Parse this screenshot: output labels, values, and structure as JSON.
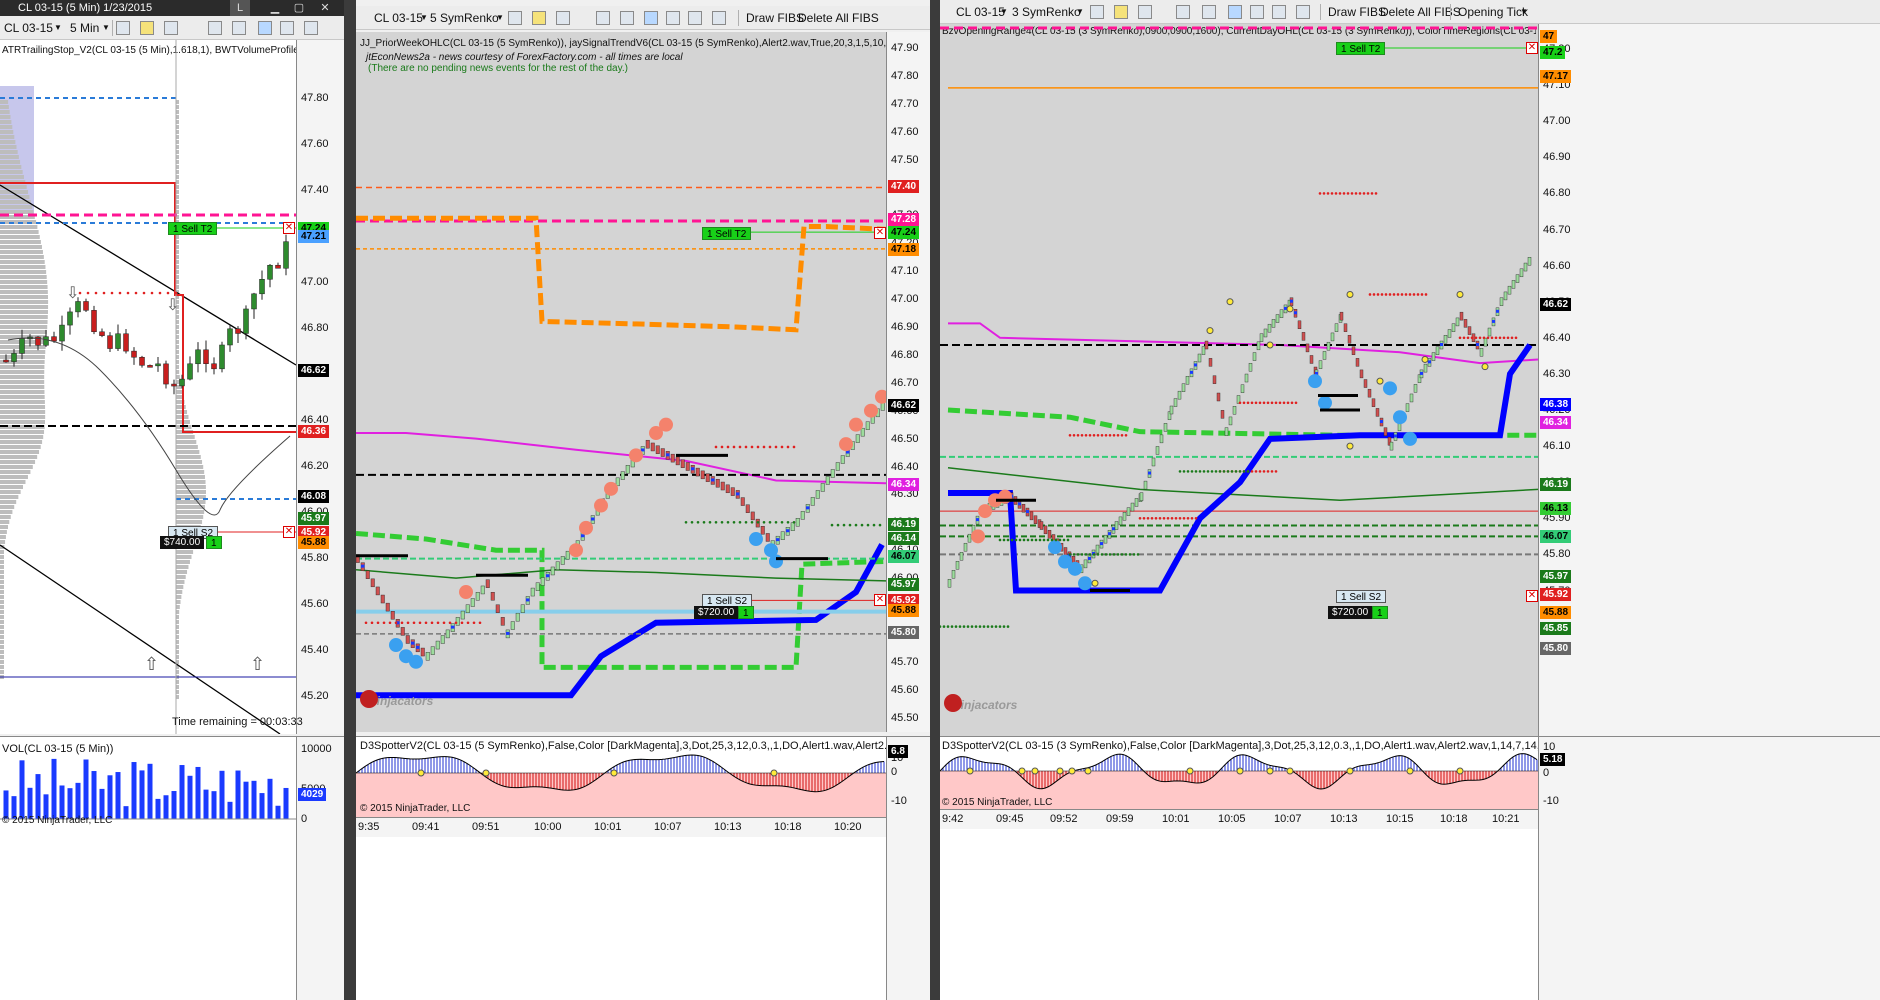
{
  "colors": {
    "bull": "#2e8b2e",
    "bear": "#c81e1e",
    "blue_trend": "#0000ff",
    "green_dash": "#33cc33",
    "orange_dash": "#ff8c00",
    "magenta": "#e020e0",
    "pink_dash": "#ff1493",
    "salmon": "#f4826c",
    "sky": "#3aa0f0"
  },
  "left": {
    "title": "CL 03-15 (5 Min)  1/23/2015",
    "title_btn": "L",
    "toolbar": {
      "instrument": "CL 03-15",
      "interval": "5 Min"
    },
    "indicator_label": "ATRTrailingStop_V2(CL 03-15 (5 Min),1.618,1), BWTVolumeProfile(CL",
    "axis_ticks": [
      "47.80",
      "47.60",
      "47.40",
      "47.20",
      "47.00",
      "46.80",
      "46.60",
      "46.40",
      "46.20",
      "46.00",
      "45.80",
      "45.60",
      "45.40",
      "45.20"
    ],
    "tags": [
      {
        "text": "47.24",
        "bg": "#18d018",
        "color": "#000"
      },
      {
        "text": "47.21",
        "bg": "#4aa0ff",
        "color": "#000"
      },
      {
        "text": "46.62",
        "bg": "#000",
        "color": "#fff"
      },
      {
        "text": "46.36",
        "bg": "#e02020",
        "color": "#fff"
      },
      {
        "text": "46.08",
        "bg": "#000",
        "color": "#fff"
      },
      {
        "text": "45.97",
        "bg": "#1b7a1b",
        "color": "#fff"
      },
      {
        "text": "45.92",
        "bg": "#e02020",
        "color": "#fff"
      },
      {
        "text": "45.88",
        "bg": "#ff8c00",
        "color": "#000"
      }
    ],
    "order_t2": "1  Sell T2",
    "order_s2": "1  Sell S2",
    "pl": "$740.00",
    "pl_qty": "1",
    "time_remaining": "Time remaining = 00:03:33",
    "vol_label": "VOL(CL 03-15 (5 Min))",
    "vol_ticks": [
      "10000",
      "5000",
      "0"
    ],
    "vol_tag": "4029",
    "copyright": "© 2015 NinjaTrader, LLC"
  },
  "middle": {
    "toolbar": {
      "instrument": "CL 03-15",
      "interval": "5 SymRenko",
      "draw_fibs": "Draw FIBS",
      "delete_fibs": "Delete All FIBS"
    },
    "indicator_label": "JJ_PriorWeekOHLC(CL 03-15 (5 SymRenko)), jaySignalTrendV6(CL 03-15 (5 SymRenko),Alert2.wav,True,20,3,1,5,10,20,20,20",
    "news_title": "jtEconNews2a - news courtesy of ForexFactory.com - all times are local",
    "news_msg": "(There are no pending news events for the rest of the day.)",
    "axis_ticks": [
      "47.90",
      "47.80",
      "47.70",
      "47.60",
      "47.50",
      "47.40",
      "47.30",
      "47.20",
      "47.10",
      "47.00",
      "46.90",
      "46.80",
      "46.70",
      "46.60",
      "46.50",
      "46.40",
      "46.30",
      "46.20",
      "46.10",
      "46.00",
      "45.90",
      "45.80",
      "45.70",
      "45.60",
      "45.50"
    ],
    "tags": [
      {
        "text": "47.40",
        "bg": "#e02020",
        "color": "#fff"
      },
      {
        "text": "47.28",
        "bg": "#ff1493",
        "color": "#fff"
      },
      {
        "text": "47.24",
        "bg": "#18d018",
        "color": "#000"
      },
      {
        "text": "47.18",
        "bg": "#ff8c00",
        "color": "#000"
      },
      {
        "text": "46.62",
        "bg": "#000",
        "color": "#fff"
      },
      {
        "text": "46.34",
        "bg": "#e020e0",
        "color": "#fff"
      },
      {
        "text": "46.19",
        "bg": "#1b7a1b",
        "color": "#fff"
      },
      {
        "text": "46.14",
        "bg": "#1b7a1b",
        "color": "#fff"
      },
      {
        "text": "46.07",
        "bg": "#33cc77",
        "color": "#000"
      },
      {
        "text": "45.97",
        "bg": "#1b7a1b",
        "color": "#fff"
      },
      {
        "text": "45.92",
        "bg": "#e02020",
        "color": "#fff"
      },
      {
        "text": "45.88",
        "bg": "#ff8c00",
        "color": "#000"
      },
      {
        "text": "45.80",
        "bg": "#666",
        "color": "#fff"
      }
    ],
    "order_t2": "1  Sell T2",
    "order_s2": "1  Sell S2",
    "pl": "$720.00",
    "pl_qty": "1",
    "logo": "Ninjacators",
    "spotter_label": "D3SpotterV2(CL 03-15 (5 SymRenko),False,Color [DarkMagenta],3,Dot,25,3,12,0.3,,1,DO,Alert1.wav,Alert2.wav,1,14,7,14,High",
    "spotter_ticks": [
      "10",
      "0",
      "-10"
    ],
    "spotter_tag": "6.8",
    "x_ticks": [
      "9:35",
      "09:41",
      "09:51",
      "10:00",
      "10:01",
      "10:07",
      "10:13",
      "10:18",
      "10:20"
    ],
    "copyright": "© 2015 NinjaTrader, LLC"
  },
  "right": {
    "toolbar": {
      "instrument": "CL 03-15",
      "interval": "3 SymRenko",
      "draw_fibs": "Draw FIBS",
      "delete_fibs": "Delete All FIBS",
      "opening_tick": "Opening Tick"
    },
    "indicator_label": "BzvOpeningRange4(CL 03-15 (3 SymRenko),0900,0900,1600), CurrentDayOHL(CL 03-15 (3 SymRenko)), ColorTimeRegions(CL 03-15 (3 SymR",
    "axis_ticks": [
      "47.20",
      "47.10",
      "47.00",
      "46.90",
      "46.80",
      "46.70",
      "46.60",
      "46.50",
      "46.40",
      "46.30",
      "46.20",
      "46.10",
      "46.00",
      "45.90",
      "45.80",
      "45.70",
      "45.60"
    ],
    "tags": [
      {
        "text": "47",
        "bg": "#ff8c00",
        "color": "#000"
      },
      {
        "text": "47.2",
        "bg": "#18d018",
        "color": "#000"
      },
      {
        "text": "47.17",
        "bg": "#ff8c00",
        "color": "#000"
      },
      {
        "text": "46.62",
        "bg": "#000",
        "color": "#fff"
      },
      {
        "text": "46.38",
        "bg": "#0000ff",
        "color": "#fff"
      },
      {
        "text": "46.34",
        "bg": "#e020e0",
        "color": "#fff"
      },
      {
        "text": "46.19",
        "bg": "#1b7a1b",
        "color": "#fff"
      },
      {
        "text": "46.13",
        "bg": "#33cc33",
        "color": "#000"
      },
      {
        "text": "46.07",
        "bg": "#33cc77",
        "color": "#000"
      },
      {
        "text": "45.97",
        "bg": "#1b7a1b",
        "color": "#fff"
      },
      {
        "text": "45.92",
        "bg": "#e02020",
        "color": "#fff"
      },
      {
        "text": "45.88",
        "bg": "#ff8c00",
        "color": "#000"
      },
      {
        "text": "45.85",
        "bg": "#1b7a1b",
        "color": "#fff"
      },
      {
        "text": "45.80",
        "bg": "#666",
        "color": "#fff"
      }
    ],
    "order_t2": "1  Sell T2",
    "order_s2": "1  Sell S2",
    "pl": "$720.00",
    "pl_qty": "1",
    "logo": "Ninjacators",
    "spotter_label": "D3SpotterV2(CL 03-15 (3 SymRenko),False,Color [DarkMagenta],3,Dot,25,3,12,0.3,,1,DO,Alert1.wav,Alert2.wav,1,14,7,14,High,Low,10,30, True",
    "spotter_ticks": [
      "10",
      "0",
      "-10"
    ],
    "spotter_tag": "5.18",
    "x_ticks": [
      "9:42",
      "09:45",
      "09:52",
      "09:59",
      "10:01",
      "10:05",
      "10:07",
      "10:13",
      "10:15",
      "10:18",
      "10:21"
    ],
    "copyright": "© 2015 NinjaTrader, LLC"
  }
}
